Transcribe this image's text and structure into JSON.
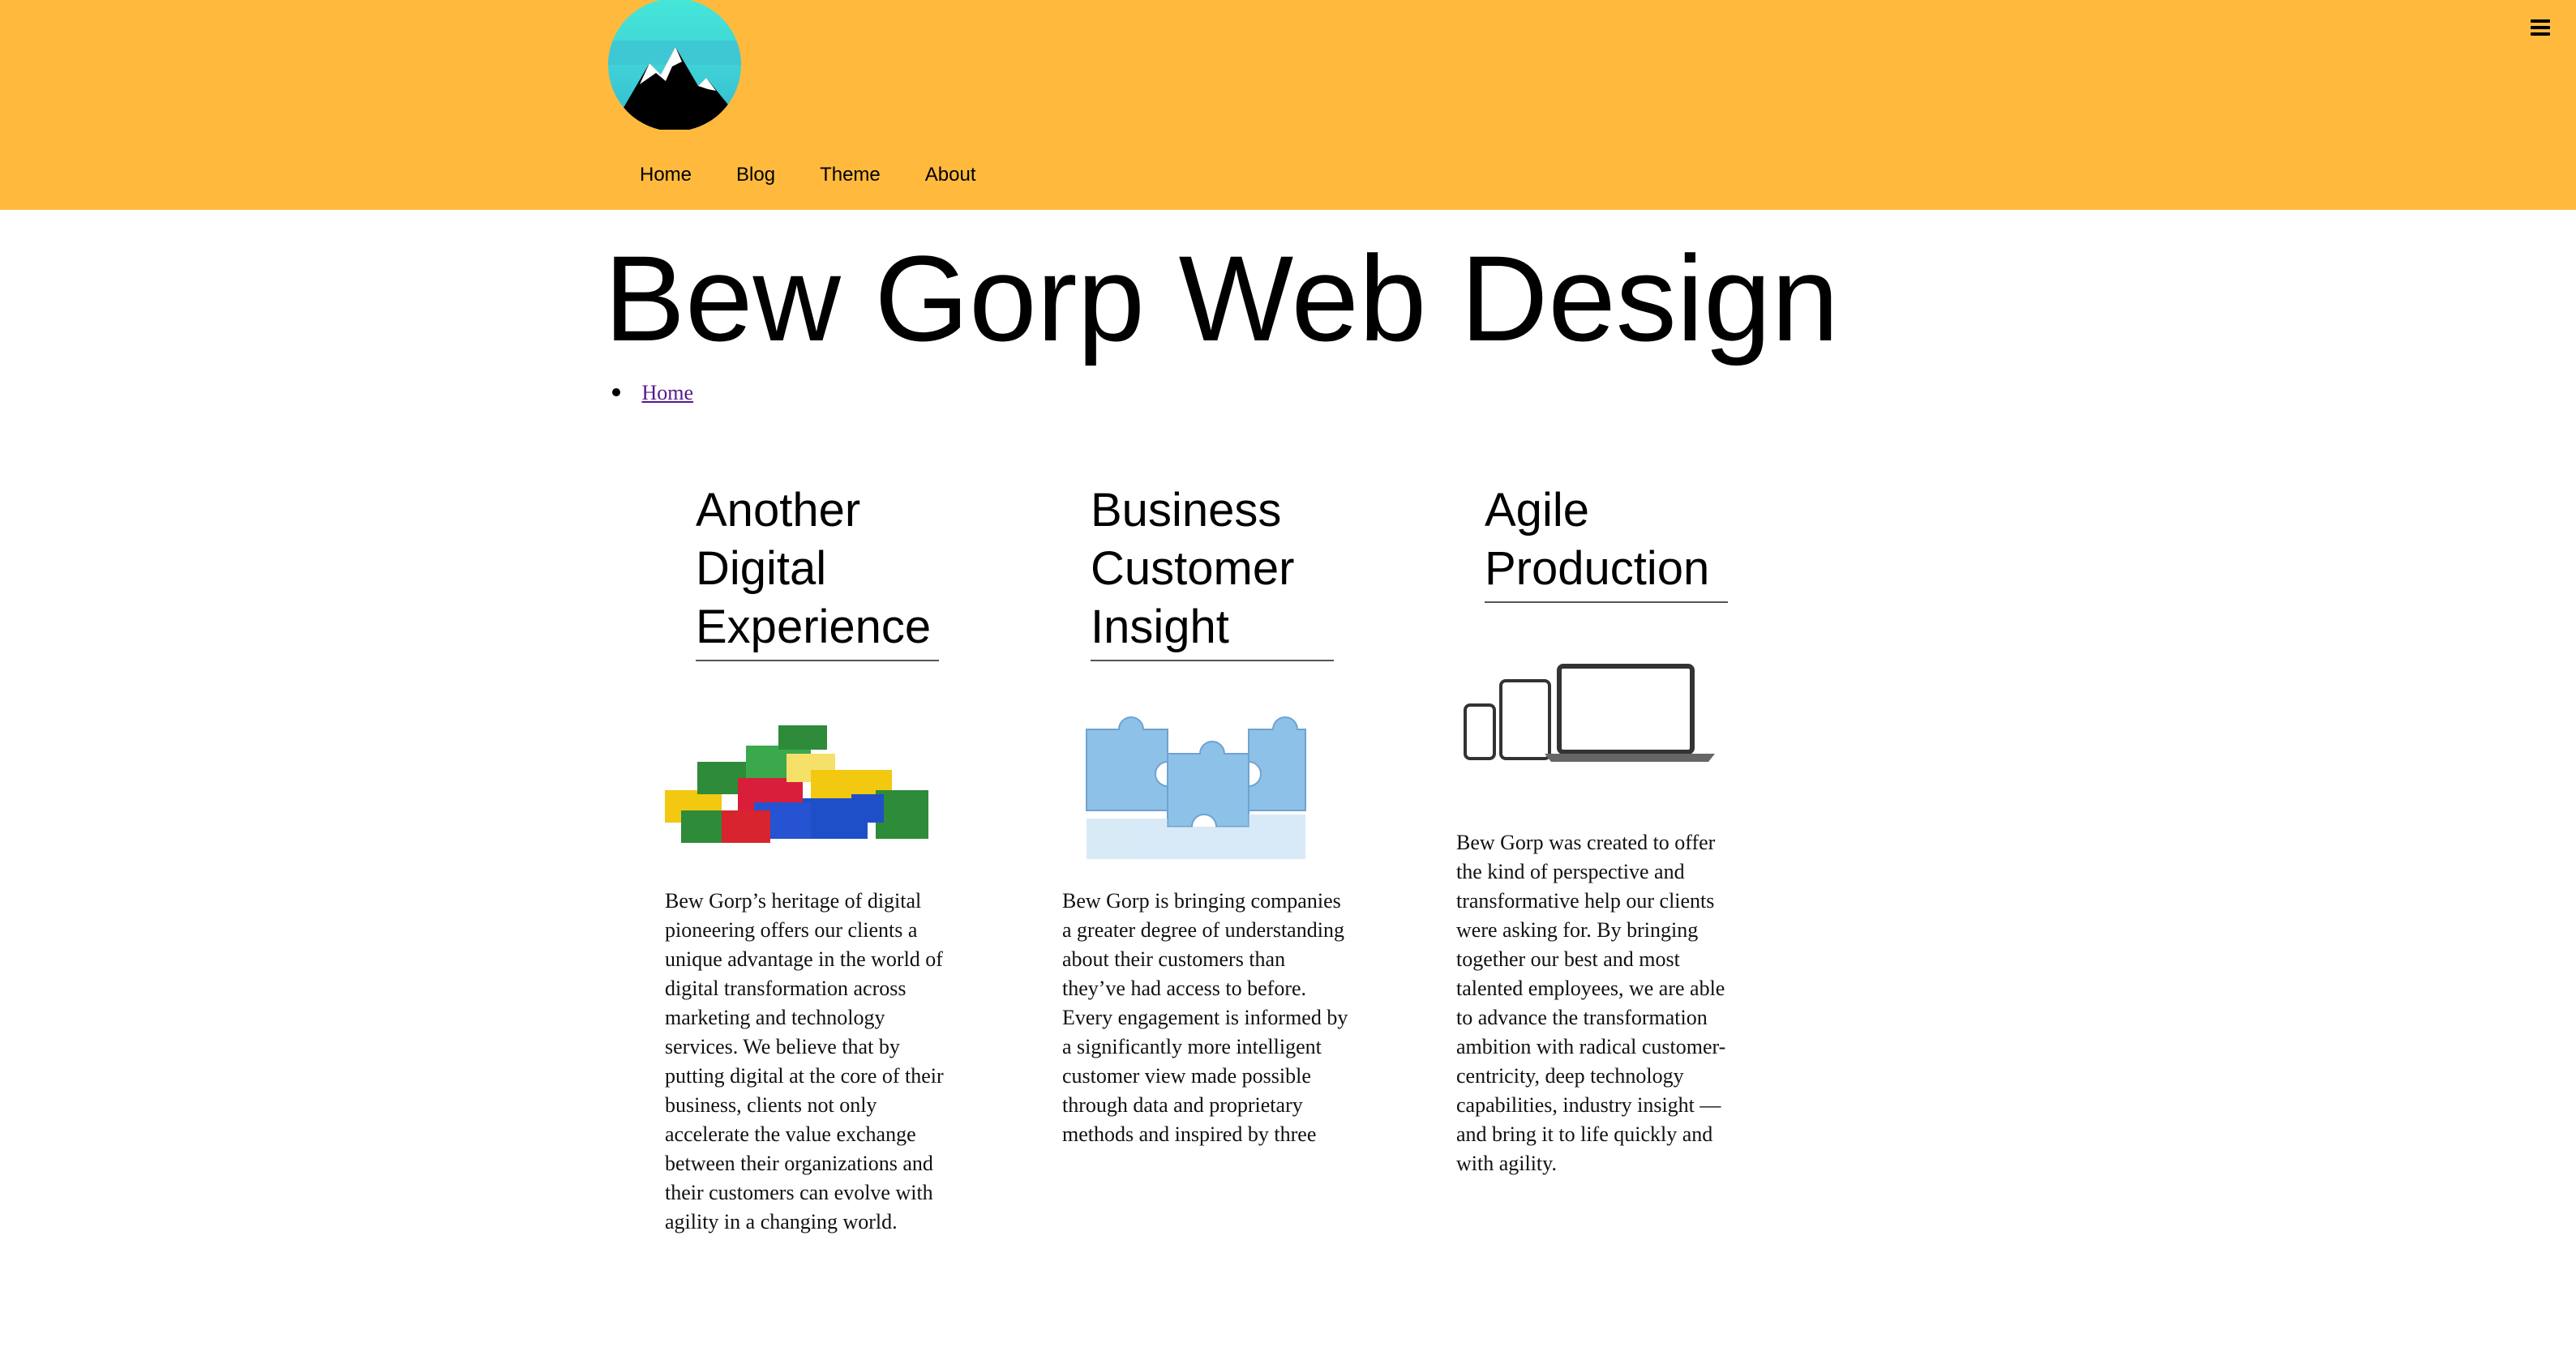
{
  "header": {
    "logo_alt": "mountain logo",
    "nav": [
      {
        "label": "Home"
      },
      {
        "label": "Blog"
      },
      {
        "label": "Theme"
      },
      {
        "label": "About"
      }
    ],
    "menu_icon": "hamburger-menu-icon",
    "background_color": "#FFBA3E"
  },
  "site": {
    "title": "Bew Gorp Web Design"
  },
  "breadcrumb": {
    "items": [
      "Home"
    ]
  },
  "columns": [
    {
      "title": "Another Digital Experience",
      "image": "lego-bricks-image",
      "text": "Bew Gorp’s heritage of digital pioneering offers our clients a unique advantage in the world of digital transformation across marketing and technology services. We believe that by putting digital at the core of their business, clients not only accelerate the value exchange between their organizations and their customers can evolve with agility in a changing world."
    },
    {
      "title": "Business Customer Insight",
      "image": "puzzle-pieces-image",
      "text": "Bew Gorp is bringing companies a greater degree of understanding about their customers than they’ve had access to before. Every engagement is informed by a significantly more intelligent customer view made possible through data and proprietary methods and inspired by three"
    },
    {
      "title": "Agile Production",
      "image": "devices-image",
      "text": "Bew Gorp was created to offer the kind of perspective and transformative help our clients were asking for. By bringing together our best and most talented employees, we are able to advance the transformation ambition with radical customer-centricity, deep technology capabilities, industry insight — and bring it to life quickly and with agility."
    }
  ]
}
